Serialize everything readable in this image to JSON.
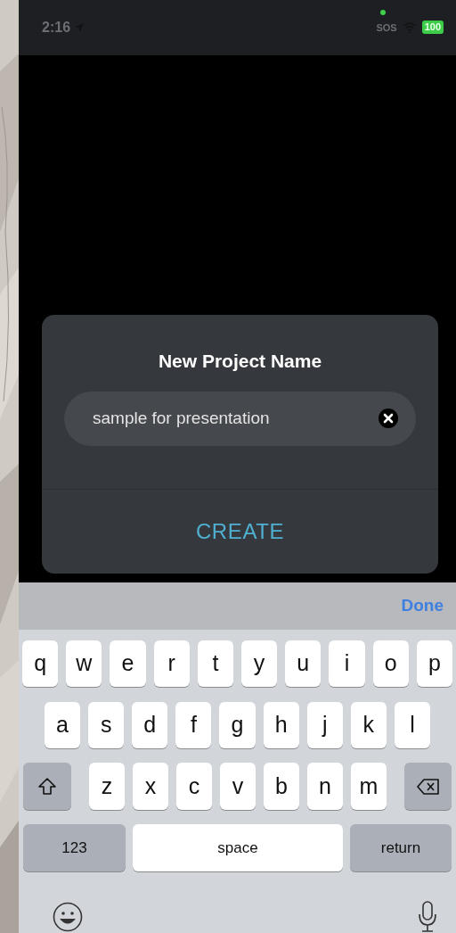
{
  "status_bar": {
    "time": "2:16",
    "carrier": "SOS",
    "battery": "100",
    "camera_in_use": true
  },
  "dialog": {
    "title": "New Project Name",
    "field": {
      "value": "sample for presentation"
    },
    "button": "CREATE"
  },
  "keyboard": {
    "toolbar": {
      "done": "Done"
    },
    "rows": [
      {
        "keys": [
          {
            "kind": "letter",
            "label": "q"
          },
          {
            "kind": "letter",
            "label": "w"
          },
          {
            "kind": "letter",
            "label": "e"
          },
          {
            "kind": "letter",
            "label": "r"
          },
          {
            "kind": "letter",
            "label": "t"
          },
          {
            "kind": "letter",
            "label": "y"
          },
          {
            "kind": "letter",
            "label": "u"
          },
          {
            "kind": "letter",
            "label": "i"
          },
          {
            "kind": "letter",
            "label": "o"
          },
          {
            "kind": "letter",
            "label": "p"
          }
        ]
      },
      {
        "keys": [
          {
            "kind": "letter",
            "label": "a"
          },
          {
            "kind": "letter",
            "label": "s"
          },
          {
            "kind": "letter",
            "label": "d"
          },
          {
            "kind": "letter",
            "label": "f"
          },
          {
            "kind": "letter",
            "label": "g"
          },
          {
            "kind": "letter",
            "label": "h"
          },
          {
            "kind": "letter",
            "label": "j"
          },
          {
            "kind": "letter",
            "label": "k"
          },
          {
            "kind": "letter",
            "label": "l"
          }
        ]
      },
      {
        "keys": [
          {
            "kind": "shift"
          },
          {
            "kind": "letter",
            "label": "z"
          },
          {
            "kind": "letter",
            "label": "x"
          },
          {
            "kind": "letter",
            "label": "c"
          },
          {
            "kind": "letter",
            "label": "v"
          },
          {
            "kind": "letter",
            "label": "b"
          },
          {
            "kind": "letter",
            "label": "n"
          },
          {
            "kind": "letter",
            "label": "m"
          },
          {
            "kind": "backspace"
          }
        ]
      },
      {
        "keys": [
          {
            "kind": "mode",
            "label": "123"
          },
          {
            "kind": "space",
            "label": "space"
          },
          {
            "kind": "return",
            "label": "return"
          }
        ]
      }
    ]
  }
}
